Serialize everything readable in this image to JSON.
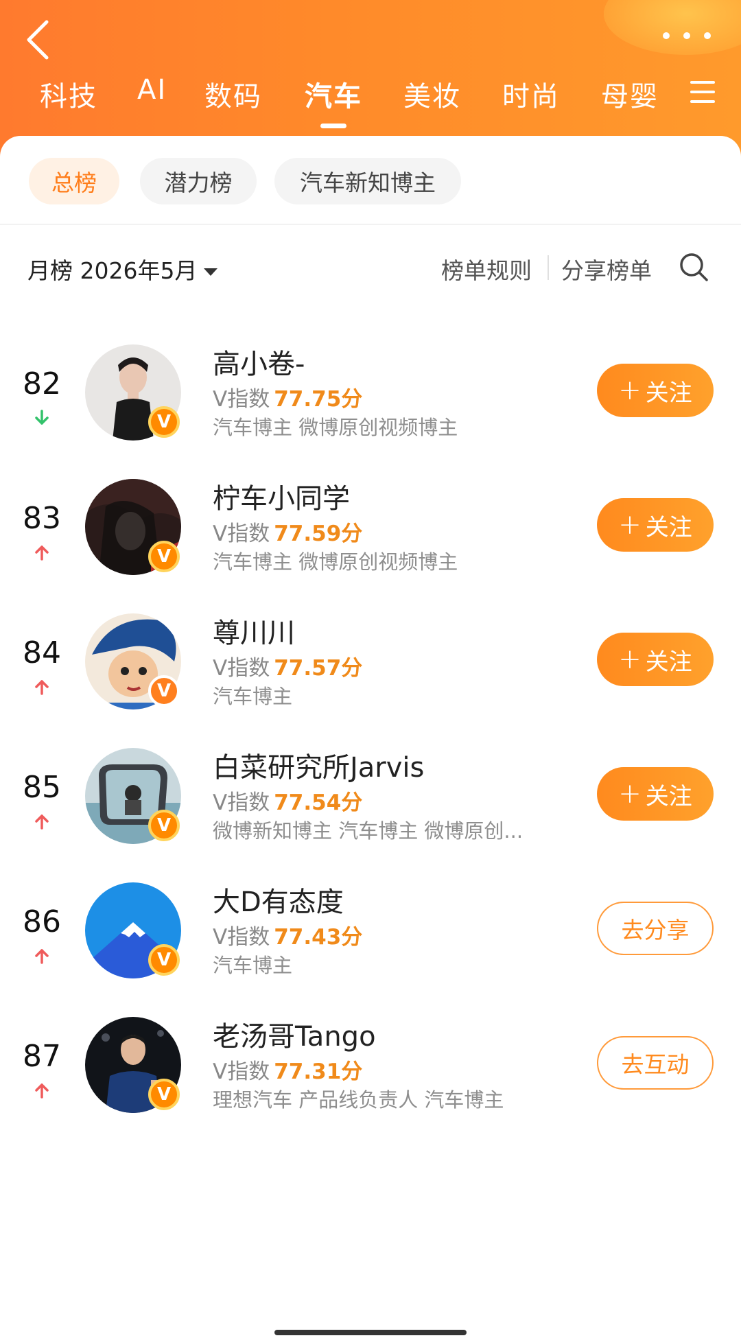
{
  "header": {
    "tabs": [
      "科技",
      "AI",
      "数码",
      "汽车",
      "美妆",
      "时尚",
      "母婴"
    ],
    "active_tab": "汽车"
  },
  "filters": {
    "items": [
      "总榜",
      "潜力榜",
      "汽车新知博主"
    ],
    "active": "总榜"
  },
  "toolbar": {
    "period": "月榜 2026年5月",
    "rules": "榜单规则",
    "share": "分享榜单"
  },
  "list": [
    {
      "rank": "82",
      "trend": "down",
      "name": "高小卷-",
      "vindex_label": "V指数",
      "score": "77.75分",
      "tags": "汽车博主 微博原创视频博主",
      "action": "关注",
      "action_type": "follow"
    },
    {
      "rank": "83",
      "trend": "up",
      "name": "柠车小同学",
      "vindex_label": "V指数",
      "score": "77.59分",
      "tags": "汽车博主 微博原创视频博主",
      "action": "关注",
      "action_type": "follow"
    },
    {
      "rank": "84",
      "trend": "up",
      "name": "尊川川",
      "vindex_label": "V指数",
      "score": "77.57分",
      "tags": "汽车博主",
      "action": "关注",
      "action_type": "follow"
    },
    {
      "rank": "85",
      "trend": "up",
      "name": "白菜研究所Jarvis",
      "vindex_label": "V指数",
      "score": "77.54分",
      "tags": "微博新知博主 汽车博主 微博原创...",
      "action": "关注",
      "action_type": "follow"
    },
    {
      "rank": "86",
      "trend": "up",
      "name": "大D有态度",
      "vindex_label": "V指数",
      "score": "77.43分",
      "tags": "汽车博主",
      "action": "去分享",
      "action_type": "outline"
    },
    {
      "rank": "87",
      "trend": "up",
      "name": "老汤哥Tango",
      "vindex_label": "V指数",
      "score": "77.31分",
      "tags": "理想汽车 产品线负责人 汽车博主",
      "action": "去互动",
      "action_type": "outline"
    }
  ],
  "colors": {
    "header_orange": "#ff8a2a",
    "accent": "#ff8a1e",
    "score": "#f08a1a",
    "trend_up": "#ef5b5b",
    "trend_down": "#33c26b"
  },
  "icons": {
    "back": "chevron-left-icon",
    "more": "more-dots-icon",
    "menu": "menu-icon",
    "search": "search-icon",
    "verified": "verified-v-icon"
  }
}
